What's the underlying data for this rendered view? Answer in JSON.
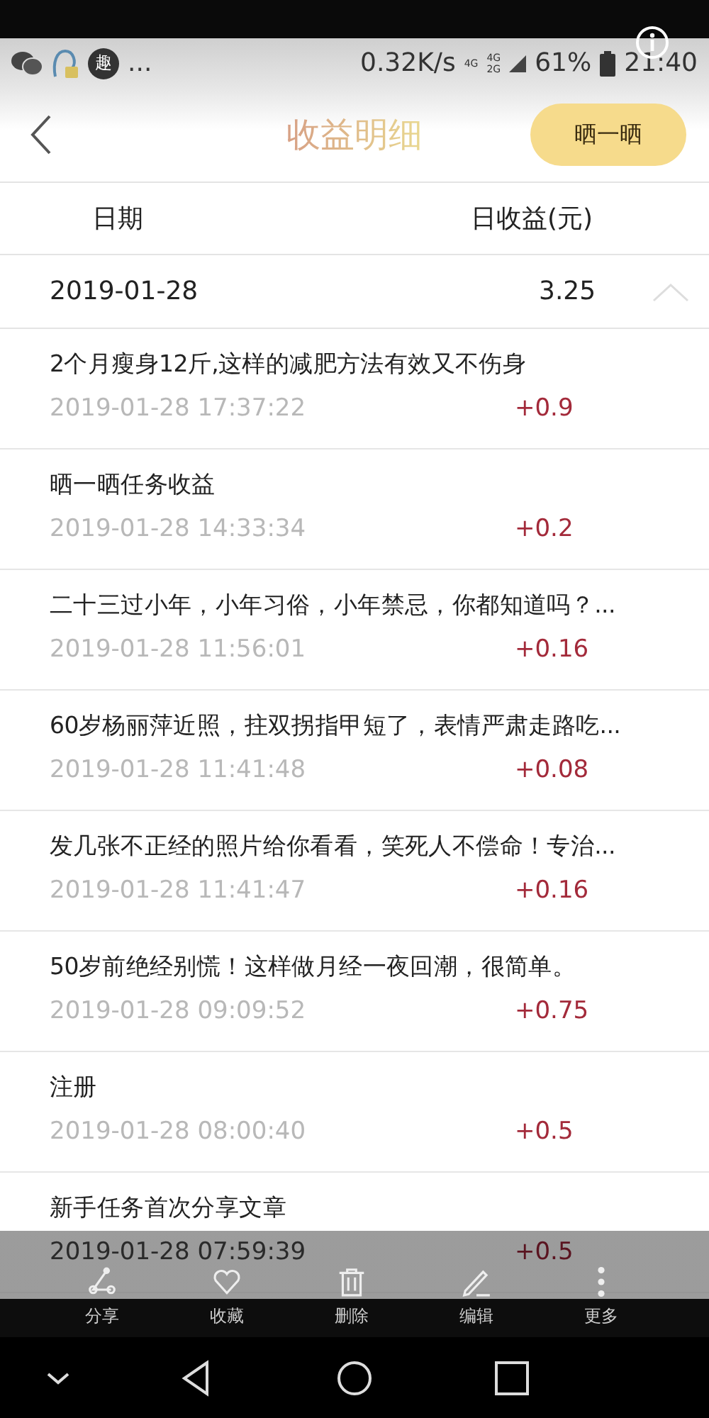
{
  "status_bar": {
    "badge": "趣",
    "more": "...",
    "speed": "0.32K/s",
    "network": [
      "4G",
      "4G",
      "2G"
    ],
    "battery": "61%",
    "time": "21:40"
  },
  "header": {
    "title": "收益明细",
    "action": "晒一晒"
  },
  "columns": [
    "日期",
    "日收益(元)"
  ],
  "group": {
    "date": "2019-01-28",
    "total": "3.25",
    "expanded": true
  },
  "items": [
    {
      "title": "2个月瘦身12斤,这样的减肥方法有效又不伤身",
      "time": "2019-01-28 17:37:22",
      "amount": "+0.9"
    },
    {
      "title": "晒一晒任务收益",
      "time": "2019-01-28 14:33:34",
      "amount": "+0.2"
    },
    {
      "title": "二十三过小年，小年习俗，小年禁忌，你都知道吗？...",
      "time": "2019-01-28 11:56:01",
      "amount": "+0.16"
    },
    {
      "title": "60岁杨丽萍近照，拄双拐指甲短了，表情严肃走路吃...",
      "time": "2019-01-28 11:41:48",
      "amount": "+0.08"
    },
    {
      "title": "发几张不正经的照片给你看看，笑死人不偿命！专治...",
      "time": "2019-01-28 11:41:47",
      "amount": "+0.16"
    },
    {
      "title": "50岁前绝经别慌！这样做月经一夜回潮，很简单。",
      "time": "2019-01-28 09:09:52",
      "amount": "+0.75"
    },
    {
      "title": "注册",
      "time": "2019-01-28 08:00:40",
      "amount": "+0.5"
    },
    {
      "title": "新手任务首次分享文章",
      "time": "2019-01-28 07:59:39",
      "amount": "+0.5"
    }
  ],
  "toolbar": [
    {
      "kind": "share",
      "label": "分享"
    },
    {
      "kind": "heart",
      "label": "收藏"
    },
    {
      "kind": "trash",
      "label": "删除"
    },
    {
      "kind": "pen",
      "label": "编辑"
    },
    {
      "kind": "more",
      "label": "更多"
    }
  ]
}
